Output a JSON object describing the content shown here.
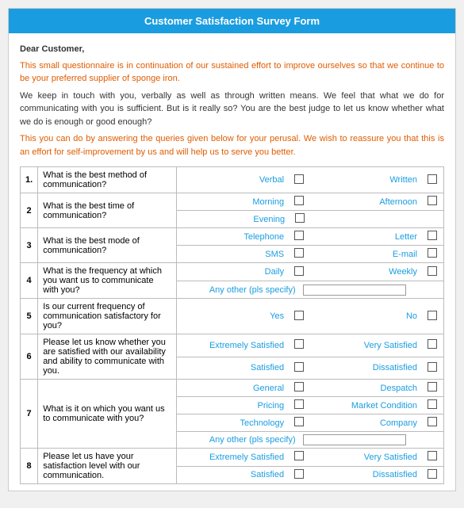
{
  "header": {
    "title": "Customer Satisfaction Survey Form"
  },
  "intro": {
    "greeting": "Dear Customer,",
    "p1": "This small questionnaire is in continuation of our sustained effort to improve ourselves so that we continue to be your preferred supplier of sponge iron.",
    "p2": "We keep in touch with you, verbally as well as through written means. We feel that what we do for communicating with you is sufficient. But is it really so? You are the best judge to let us know whether what we do is enough or good enough?",
    "p3": "This you can do by answering the queries given below for your perusal. We wish to reassure you that this is an effort for self-improvement by us and will help us to serve you better."
  },
  "questions": [
    {
      "num": "1.",
      "text": "What is the best method of communication?",
      "rows": [
        {
          "options": [
            {
              "label": "Verbal",
              "checkbox": true
            },
            {
              "label": "Written",
              "checkbox": true
            }
          ]
        }
      ]
    },
    {
      "num": "2",
      "text": "What is the best time of communication?",
      "rows": [
        {
          "options": [
            {
              "label": "Morning",
              "checkbox": true
            },
            {
              "label": "Afternoon",
              "checkbox": true
            }
          ]
        },
        {
          "options": [
            {
              "label": "Evening",
              "checkbox": true
            },
            {
              "label": "",
              "checkbox": false
            }
          ]
        }
      ]
    },
    {
      "num": "3",
      "text": "What is the best mode of communication?",
      "rows": [
        {
          "options": [
            {
              "label": "Telephone",
              "checkbox": true
            },
            {
              "label": "Letter",
              "checkbox": true
            }
          ]
        },
        {
          "options": [
            {
              "label": "SMS",
              "checkbox": true
            },
            {
              "label": "E-mail",
              "checkbox": true
            }
          ]
        }
      ]
    },
    {
      "num": "4",
      "text": "What is the frequency at which you want us to communicate with you?",
      "rows": [
        {
          "options": [
            {
              "label": "Daily",
              "checkbox": true
            },
            {
              "label": "Weekly",
              "checkbox": true
            }
          ]
        },
        {
          "type": "any-other",
          "label": "Any other (pls specify)"
        }
      ]
    },
    {
      "num": "5",
      "text": "Is our current frequency of communication satisfactory for you?",
      "rows": [
        {
          "options": [
            {
              "label": "Yes",
              "checkbox": true
            },
            {
              "label": "No",
              "checkbox": true
            }
          ]
        }
      ]
    },
    {
      "num": "6",
      "text": "Please let us know whether you are satisfied with our availability and ability to communicate with you.",
      "rows": [
        {
          "options": [
            {
              "label": "Extremely Satisfied",
              "checkbox": true
            },
            {
              "label": "Very Satisfied",
              "checkbox": true
            }
          ]
        },
        {
          "options": [
            {
              "label": "Satisfied",
              "checkbox": true
            },
            {
              "label": "Dissatisfied",
              "checkbox": true
            }
          ]
        }
      ]
    },
    {
      "num": "7",
      "text": "What is it on which you want us to communicate with you?",
      "rows": [
        {
          "options": [
            {
              "label": "General",
              "checkbox": true
            },
            {
              "label": "Despatch",
              "checkbox": true
            }
          ]
        },
        {
          "options": [
            {
              "label": "Pricing",
              "checkbox": true
            },
            {
              "label": "Market Condition",
              "checkbox": true
            }
          ]
        },
        {
          "options": [
            {
              "label": "Technology",
              "checkbox": true
            },
            {
              "label": "Company",
              "checkbox": true
            }
          ]
        },
        {
          "type": "any-other",
          "label": "Any other (pls specify)"
        }
      ]
    },
    {
      "num": "8",
      "text": "Please let us have your satisfaction level with our communication.",
      "rows": [
        {
          "options": [
            {
              "label": "Extremely Satisfied",
              "checkbox": true
            },
            {
              "label": "Very Satisfied",
              "checkbox": true
            }
          ]
        },
        {
          "options": [
            {
              "label": "Satisfied",
              "checkbox": true
            },
            {
              "label": "Dissatisfied",
              "checkbox": true
            }
          ]
        }
      ]
    }
  ]
}
